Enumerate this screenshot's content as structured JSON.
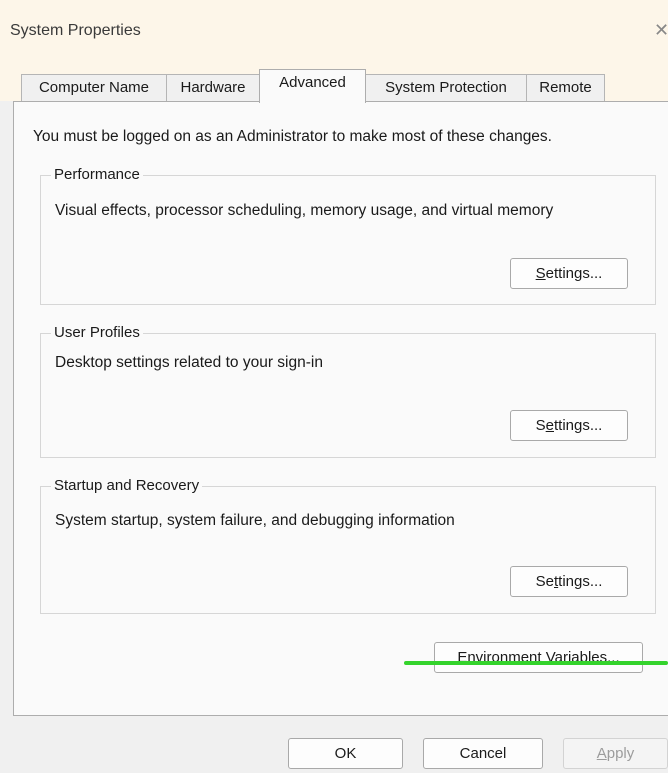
{
  "window": {
    "title": "System Properties",
    "close_glyph": "✕"
  },
  "tabs": [
    {
      "label": "Computer Name",
      "active": false
    },
    {
      "label": "Hardware",
      "active": false
    },
    {
      "label": "Advanced",
      "active": true
    },
    {
      "label": "System Protection",
      "active": false
    },
    {
      "label": "Remote",
      "active": false
    }
  ],
  "intro_text": "You must be logged on as an Administrator to make most of these changes.",
  "groups": {
    "performance": {
      "title": "Performance",
      "description": "Visual effects, processor scheduling, memory usage, and virtual memory",
      "button": {
        "pre": "",
        "mnemonic": "S",
        "post": "ettings..."
      }
    },
    "user_profiles": {
      "title": "User Profiles",
      "description": "Desktop settings related to your sign-in",
      "button": {
        "pre": "S",
        "mnemonic": "e",
        "post": "ttings..."
      }
    },
    "startup_recovery": {
      "title": "Startup and Recovery",
      "description": "System startup, system failure, and debugging information",
      "button": {
        "pre": "Se",
        "mnemonic": "t",
        "post": "tings..."
      }
    }
  },
  "env_button": {
    "pre": "Enviro",
    "mnemonic": "n",
    "post": "ment Variables..."
  },
  "footer": {
    "ok": "OK",
    "cancel": "Cancel",
    "apply": {
      "pre": "",
      "mnemonic": "A",
      "post": "pply"
    }
  },
  "colors": {
    "accent_line": "#34d32c",
    "dialog_bg": "#f0f0f0",
    "panel_bg": "#fafafa"
  }
}
